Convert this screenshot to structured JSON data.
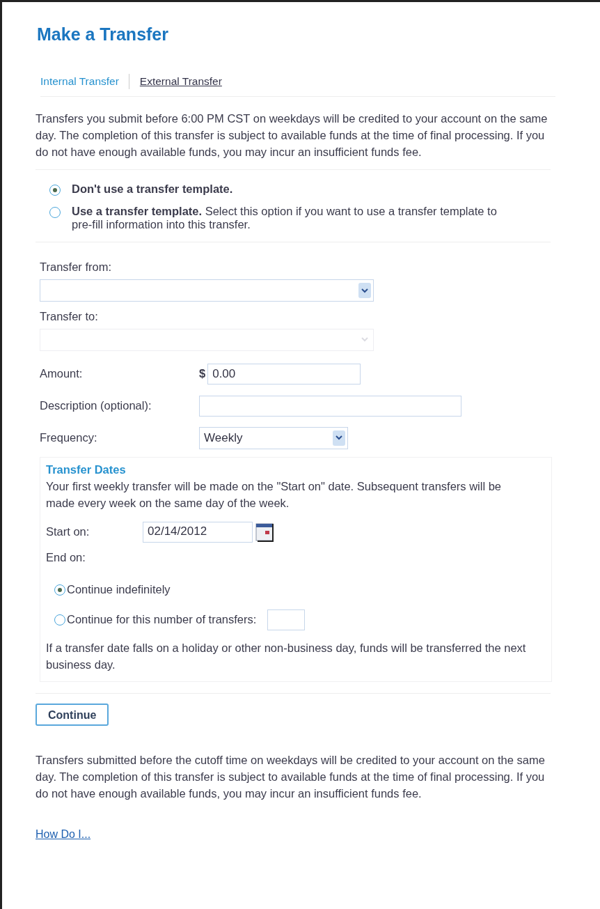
{
  "title": "Make a Transfer",
  "tabs": [
    {
      "label": "Internal Transfer",
      "selected": true
    },
    {
      "label": "External Transfer",
      "selected": false
    }
  ],
  "intro": "Transfers you submit before 6:00 PM CST on weekdays will be credited to your account on the same day. The completion of this transfer is subject to available funds at the time of final processing. If you do not have enough available funds, you may incur an insufficient funds fee.",
  "template_options": [
    {
      "text": "**Don't use a transfer template.**",
      "selected": true
    },
    {
      "text": "**Use a transfer template.** Select this option if you want to use a transfer template to pre-fill information into this transfer.",
      "selected": false
    }
  ],
  "transfer_from": {
    "label": "Transfer from:",
    "disabled": false
  },
  "transfer_to": {
    "label": "Transfer to:",
    "disabled": true
  },
  "amount": {
    "label": "Amount:",
    "currency": "$",
    "value": "0.00"
  },
  "description": {
    "label": "Description (optional):"
  },
  "frequency": {
    "label": "Frequency:",
    "value": "Weekly"
  },
  "transfer_dates": {
    "heading": "Transfer Dates",
    "text": "Your first weekly transfer will be made on the \"Start on\" date. Subsequent transfers will be made every week on the same day of the week.",
    "start_on": {
      "label": "Start on:",
      "value": "02/14/2012"
    },
    "end_on_label": "End on:",
    "end_options": [
      {
        "kind": "plain",
        "label": "Continue indefinitely",
        "selected": true
      },
      {
        "kind": "count",
        "label": "Continue for this number of transfers:",
        "selected": false
      }
    ],
    "note": "If a transfer date falls on a holiday or other non-business day, funds will be transferred the next business day."
  },
  "continue_button": "Continue",
  "footer_text": "Transfers submitted before the cutoff time on weekdays will be credited to your account on the same day. The completion of this transfer is subject to available funds at the time of final processing. If you do not have enough available funds, you may incur an insufficient funds fee.",
  "help_link": "How Do I..."
}
